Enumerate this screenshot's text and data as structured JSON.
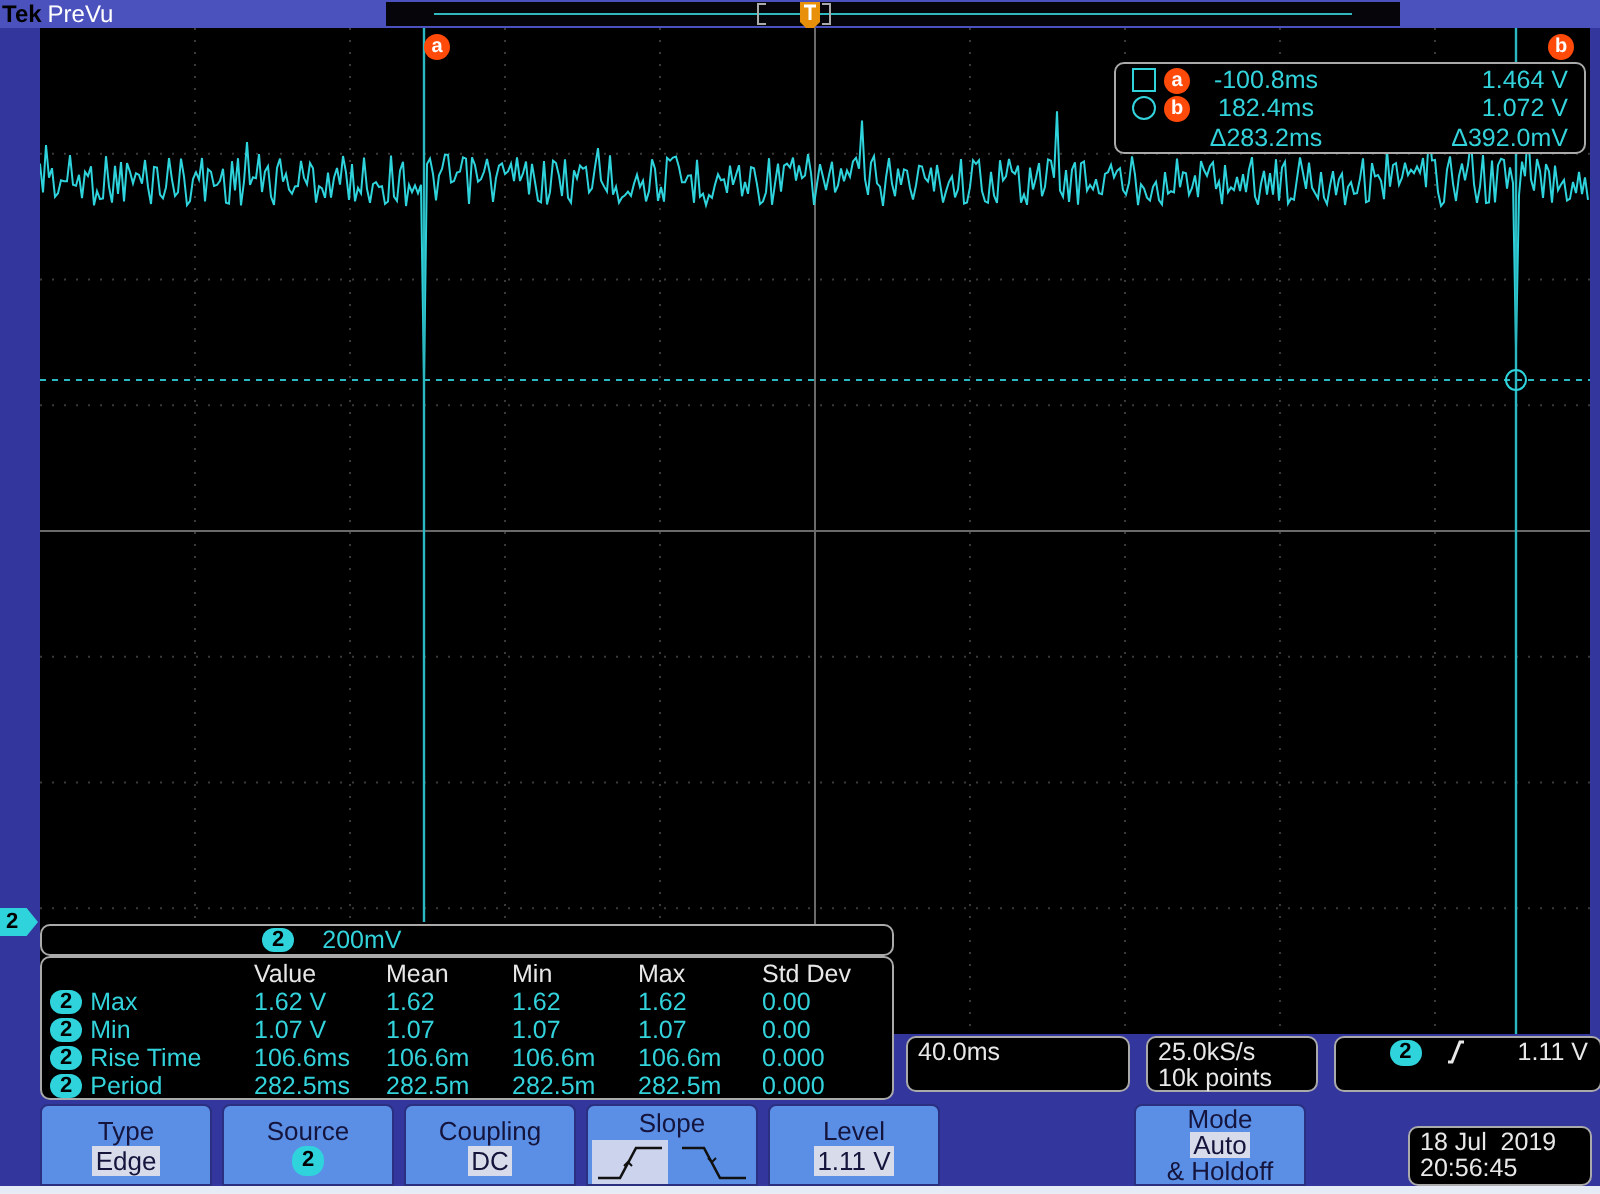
{
  "header": {
    "brand": "Tek",
    "mode": "PreVu"
  },
  "cursor_markers": [
    "a",
    "b"
  ],
  "cursor_readout": {
    "rows": [
      {
        "kind": "square",
        "label": "a",
        "time": "-100.8ms",
        "voltage": "1.464 V"
      },
      {
        "kind": "circle",
        "label": "b",
        "time": "182.4ms",
        "voltage": "1.072 V"
      },
      {
        "kind": "delta",
        "time": "Δ283.2ms",
        "voltage": "Δ392.0mV"
      }
    ]
  },
  "ground_marker": "2",
  "channel_scale": {
    "channel": "2",
    "scale": "200mV"
  },
  "measurements": {
    "columns": [
      "Value",
      "Mean",
      "Min",
      "Max",
      "Std Dev"
    ],
    "rows": [
      {
        "channel": "2",
        "name": "Max",
        "values": [
          "1.62 V",
          "1.62",
          "1.62",
          "1.62",
          "0.00"
        ]
      },
      {
        "channel": "2",
        "name": "Min",
        "values": [
          "1.07 V",
          "1.07",
          "1.07",
          "1.07",
          "0.00"
        ]
      },
      {
        "channel": "2",
        "name": "Rise Time",
        "values": [
          "106.6ms",
          "106.6m",
          "106.6m",
          "106.6m",
          "0.000"
        ]
      },
      {
        "channel": "2",
        "name": "Period",
        "values": [
          "282.5ms",
          "282.5m",
          "282.5m",
          "282.5m",
          "0.000"
        ]
      }
    ]
  },
  "timebase": "40.0ms",
  "acquisition": {
    "rate": "25.0kS/s",
    "points": "10k points"
  },
  "trigger": {
    "channel": "2",
    "level": "1.11 V"
  },
  "menu_buttons": [
    {
      "kind": "value",
      "label": "Type",
      "value": "Edge"
    },
    {
      "kind": "channel",
      "label": "Source",
      "value": "2"
    },
    {
      "kind": "value",
      "label": "Coupling",
      "value": "DC"
    },
    {
      "kind": "slope",
      "label": "Slope",
      "options": [
        {
          "kind": "rising",
          "selected": true
        },
        {
          "kind": "falling",
          "selected": false
        }
      ]
    },
    {
      "kind": "value",
      "label": "Level",
      "value": "1.11 V"
    }
  ],
  "mode_button": {
    "label": "Mode",
    "value": "Auto",
    "suffix": "& Holdoff"
  },
  "datetime": {
    "date": "18 Jul  2019",
    "time": "20:56:45"
  }
}
